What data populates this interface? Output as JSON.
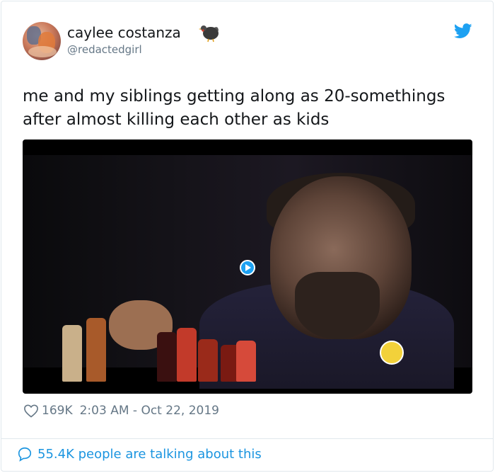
{
  "tweet": {
    "display_name": "caylee costanza",
    "handle": "@redactedgirl",
    "name_emoji": "turkey-icon",
    "text": "me and my siblings getting along as 20-somethings\nafter almost killing each other as kids",
    "likes": "169K",
    "time": "2:03 AM",
    "date_separator": "-",
    "date": "Oct 22, 2019",
    "talking": "55.4K people are talking about this"
  },
  "colors": {
    "twitter_blue": "#1da1f2",
    "link_blue": "#1b95e0",
    "muted_text": "#657786",
    "border": "#e1e8ed"
  }
}
